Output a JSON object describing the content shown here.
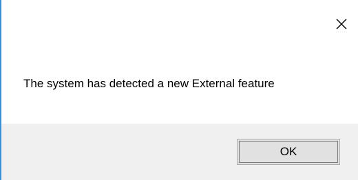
{
  "dialog": {
    "message": "The system has detected a new External feature",
    "ok_label": "OK",
    "close_icon": "close-icon"
  },
  "colors": {
    "accent_border": "#3b8fd6",
    "footer_background": "#f0f0f0",
    "button_background": "#e1e1e1"
  }
}
